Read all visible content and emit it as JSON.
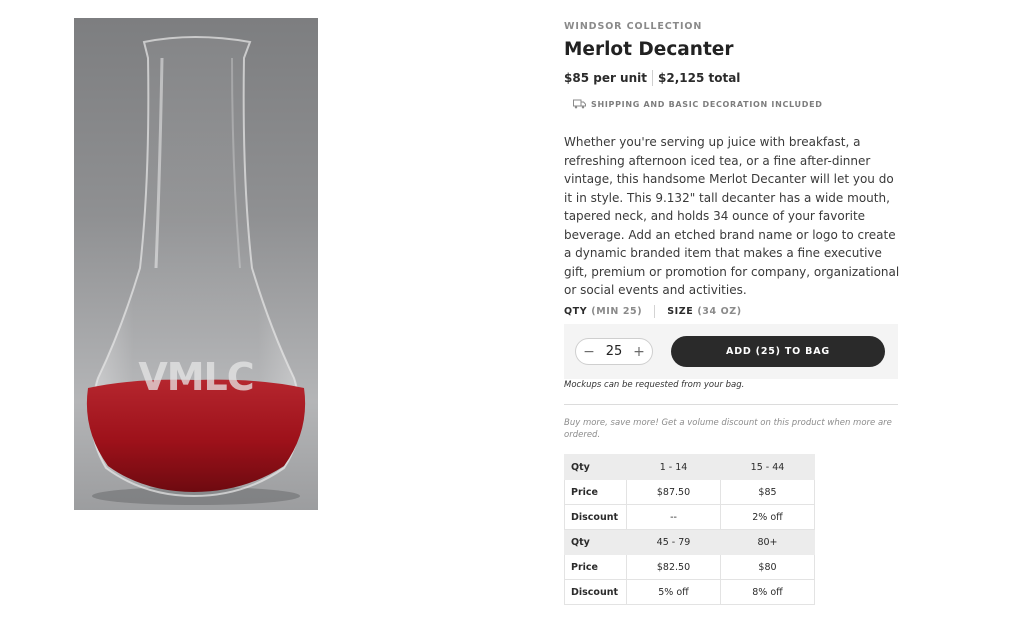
{
  "product": {
    "collection": "WINDSOR COLLECTION",
    "title": "Merlot Decanter",
    "unit_price": "$85 per unit",
    "total_price": "$2,125 total",
    "shipping_note": "SHIPPING AND BASIC DECORATION INCLUDED",
    "description": "Whether you're serving up juice with breakfast, a refreshing afternoon iced tea, or a fine after-dinner vintage, this handsome Merlot Decanter will let you do it in style. This 9.132\" tall decanter has a wide mouth, tapered neck, and holds 34 ounce of your favorite beverage. Add an etched brand name or logo to create a dynamic branded item that makes a fine executive gift, premium or promotion for company, organizational or social events and activities.",
    "image": {
      "etched_logo_text": "VMLC",
      "colors": {
        "wine": "#a0141c",
        "background": "#8f9092"
      }
    }
  },
  "options": {
    "qty_label": "QTY",
    "qty_min": "(MIN 25)",
    "size_label": "SIZE",
    "size_value": "(34 OZ)"
  },
  "purchase": {
    "decrement": "−",
    "quantity": "25",
    "increment": "+",
    "add_button": "ADD (25) TO BAG",
    "mockup_note": "Mockups can be requested from your bag.",
    "volume_note": "Buy more, save more! Get a volume discount on this product when more are ordered."
  },
  "pricing_table": {
    "rows": [
      {
        "label": "Qty",
        "a": "1 - 14",
        "b": "15 - 44"
      },
      {
        "label": "Price",
        "a": "$87.50",
        "b": "$85"
      },
      {
        "label": "Discount",
        "a": "--",
        "b": "2% off"
      },
      {
        "label": "Qty",
        "a": "45 - 79",
        "b": "80+"
      },
      {
        "label": "Price",
        "a": "$82.50",
        "b": "$80"
      },
      {
        "label": "Discount",
        "a": "5% off",
        "b": "8% off"
      }
    ]
  },
  "colors": {
    "button": "#2a2a2a",
    "buy_box": "#f4f4f4",
    "table_header": "#ececec"
  },
  "icons": {
    "shipping": "truck-icon",
    "decrement": "minus-icon",
    "increment": "plus-icon"
  }
}
